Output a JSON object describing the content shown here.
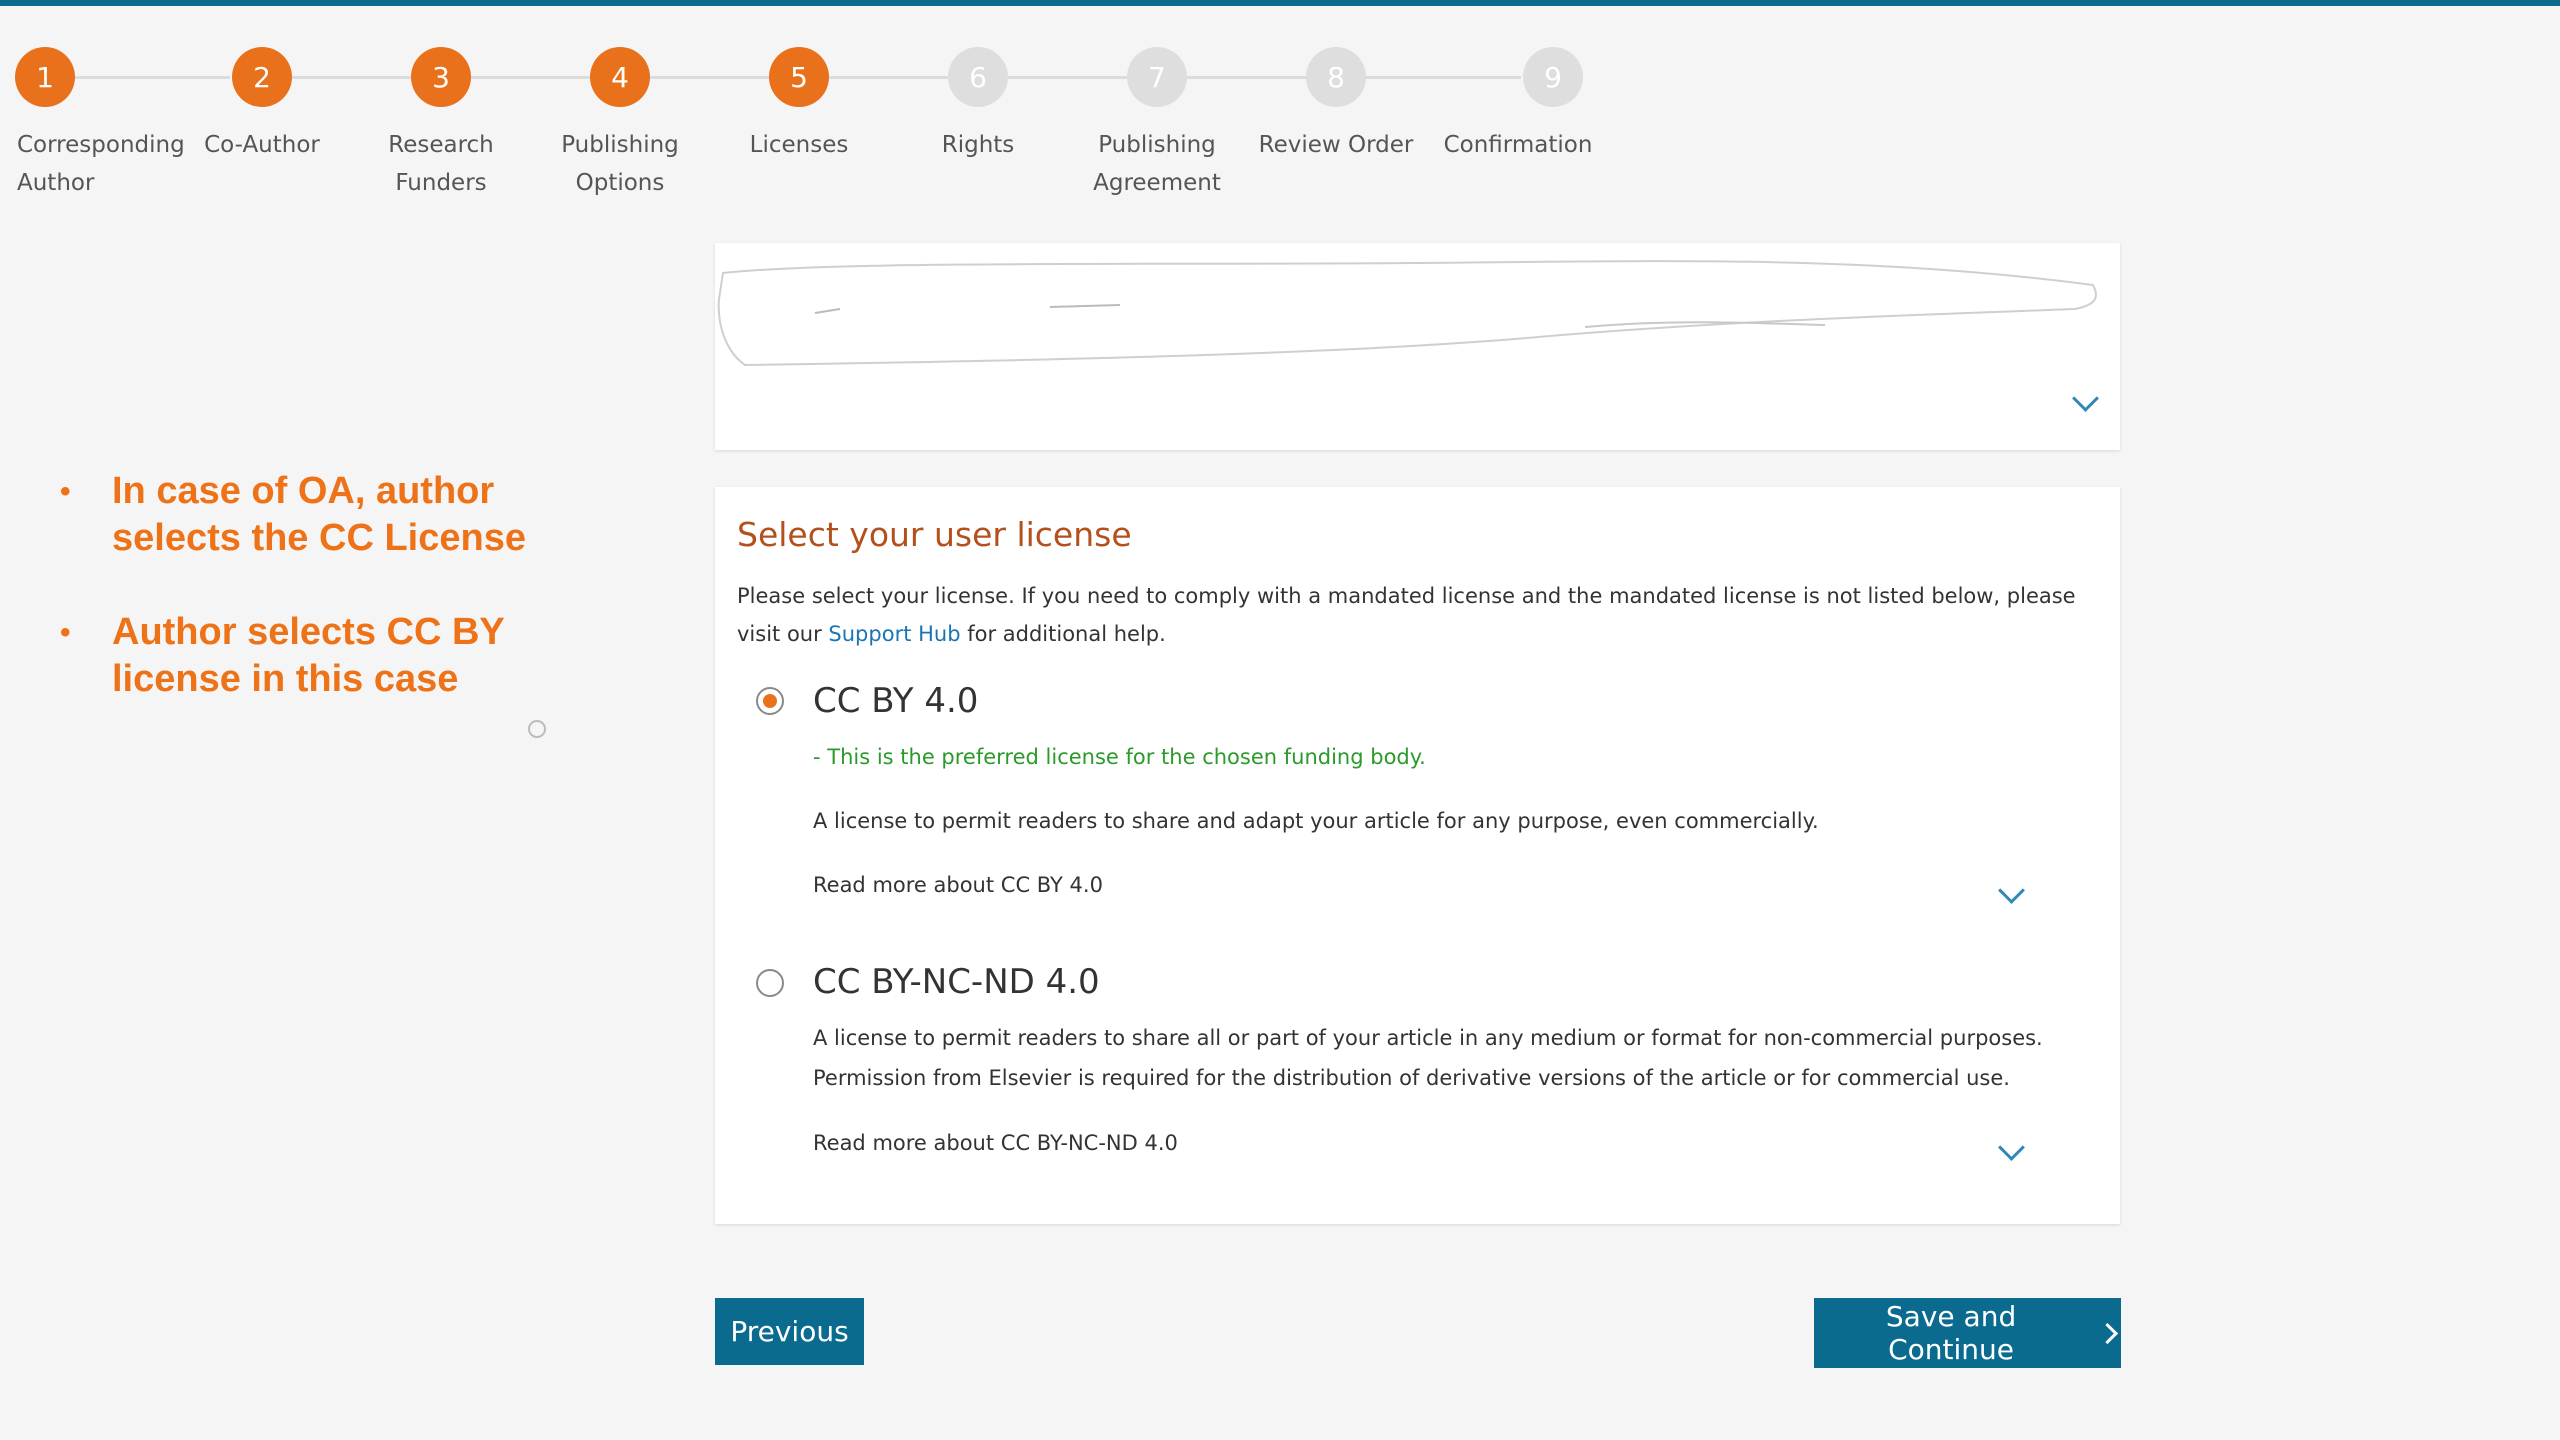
{
  "colors": {
    "accent": "#e9711c",
    "inactive_step": "#dedede",
    "primary_button": "#0a6b8f",
    "title": "#b4501c",
    "link": "#1a75b4",
    "preferred_note": "#2a9a2a",
    "annotation": "#ee7218"
  },
  "stepper": {
    "current_step": 5,
    "steps": [
      {
        "number": "1",
        "label": "Corresponding\nAuthor",
        "state": "completed"
      },
      {
        "number": "2",
        "label": "Co-Author",
        "state": "completed"
      },
      {
        "number": "3",
        "label": "Research\nFunders",
        "state": "completed"
      },
      {
        "number": "4",
        "label": "Publishing\nOptions",
        "state": "completed"
      },
      {
        "number": "5",
        "label": "Licenses",
        "state": "current"
      },
      {
        "number": "6",
        "label": "Rights",
        "state": "upcoming"
      },
      {
        "number": "7",
        "label": "Publishing\nAgreement",
        "state": "upcoming"
      },
      {
        "number": "8",
        "label": "Review Order",
        "state": "upcoming"
      },
      {
        "number": "9",
        "label": "Confirmation",
        "state": "upcoming"
      }
    ]
  },
  "article_summary": {
    "redacted": true,
    "expand_icon": "chevron-down-icon"
  },
  "annotation": {
    "bullets": [
      "In case of OA, author selects the CC License",
      "Author selects CC BY license in this case"
    ]
  },
  "license": {
    "title": "Select your user license",
    "intro_before_link": "Please select your license. If you need to comply with a mandated license and the mandated license is not listed below, please visit our ",
    "intro_link": "Support Hub",
    "intro_after_link": " for additional help.",
    "options": [
      {
        "name": "CC BY 4.0",
        "selected": true,
        "note": "- This is the preferred license for the chosen funding body.",
        "description": "A license to permit readers to share and adapt your article for any purpose, even commercially.",
        "read_more": "Read more about CC BY 4.0"
      },
      {
        "name": "CC BY-NC-ND 4.0",
        "selected": false,
        "description": "A license to permit readers to share all or part of your article in any medium or format for non-commercial purposes. Permission from Elsevier is required for the distribution of derivative versions of the article or for commercial use.",
        "read_more": "Read more about CC BY-NC-ND 4.0"
      }
    ]
  },
  "buttons": {
    "previous": "Previous",
    "save_continue": "Save and Continue"
  }
}
